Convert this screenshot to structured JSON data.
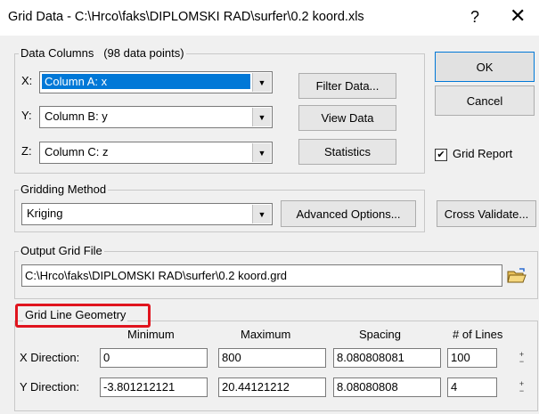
{
  "window": {
    "title": "Grid Data - C:\\Hrco\\faks\\DIPLOMSKI RAD\\surfer\\0.2 koord.xls",
    "help_glyph": "?",
    "close_glyph": "✕"
  },
  "data_columns": {
    "label": "Data Columns",
    "count_text": "(98 data points)",
    "x": {
      "label": "X:",
      "value": "Column A:  x"
    },
    "y": {
      "label": "Y:",
      "value": "Column B:  y"
    },
    "z": {
      "label": "Z:",
      "value": "Column C:  z"
    },
    "filter_button": "Filter Data...",
    "view_button": "View Data",
    "statistics_button": "Statistics"
  },
  "buttons": {
    "ok": "OK",
    "cancel": "Cancel",
    "cross_validate": "Cross Validate..."
  },
  "grid_report": {
    "label": "Grid Report",
    "checked": true,
    "check_glyph": "✔"
  },
  "gridding_method": {
    "label": "Gridding Method",
    "value": "Kriging",
    "advanced_button": "Advanced Options..."
  },
  "output_grid_file": {
    "label": "Output Grid File",
    "path": "C:\\Hrco\\faks\\DIPLOMSKI RAD\\surfer\\0.2 koord.grd",
    "browse_icon": "folder-open-icon"
  },
  "grid_line_geometry": {
    "label": "Grid Line Geometry",
    "highlight_color": "#e0141e",
    "headers": {
      "minimum": "Minimum",
      "maximum": "Maximum",
      "spacing": "Spacing",
      "lines": "# of Lines"
    },
    "x": {
      "label": "X Direction:",
      "minimum": "0",
      "maximum": "800",
      "spacing": "8.080808081",
      "lines": "100"
    },
    "y": {
      "label": "Y Direction:",
      "minimum": "-3.801212121",
      "maximum": "20.44121212",
      "spacing": "8.08080808",
      "lines": "4"
    }
  },
  "colors": {
    "selection": "#0078d7",
    "dialog_bg": "#f0f0f0"
  }
}
